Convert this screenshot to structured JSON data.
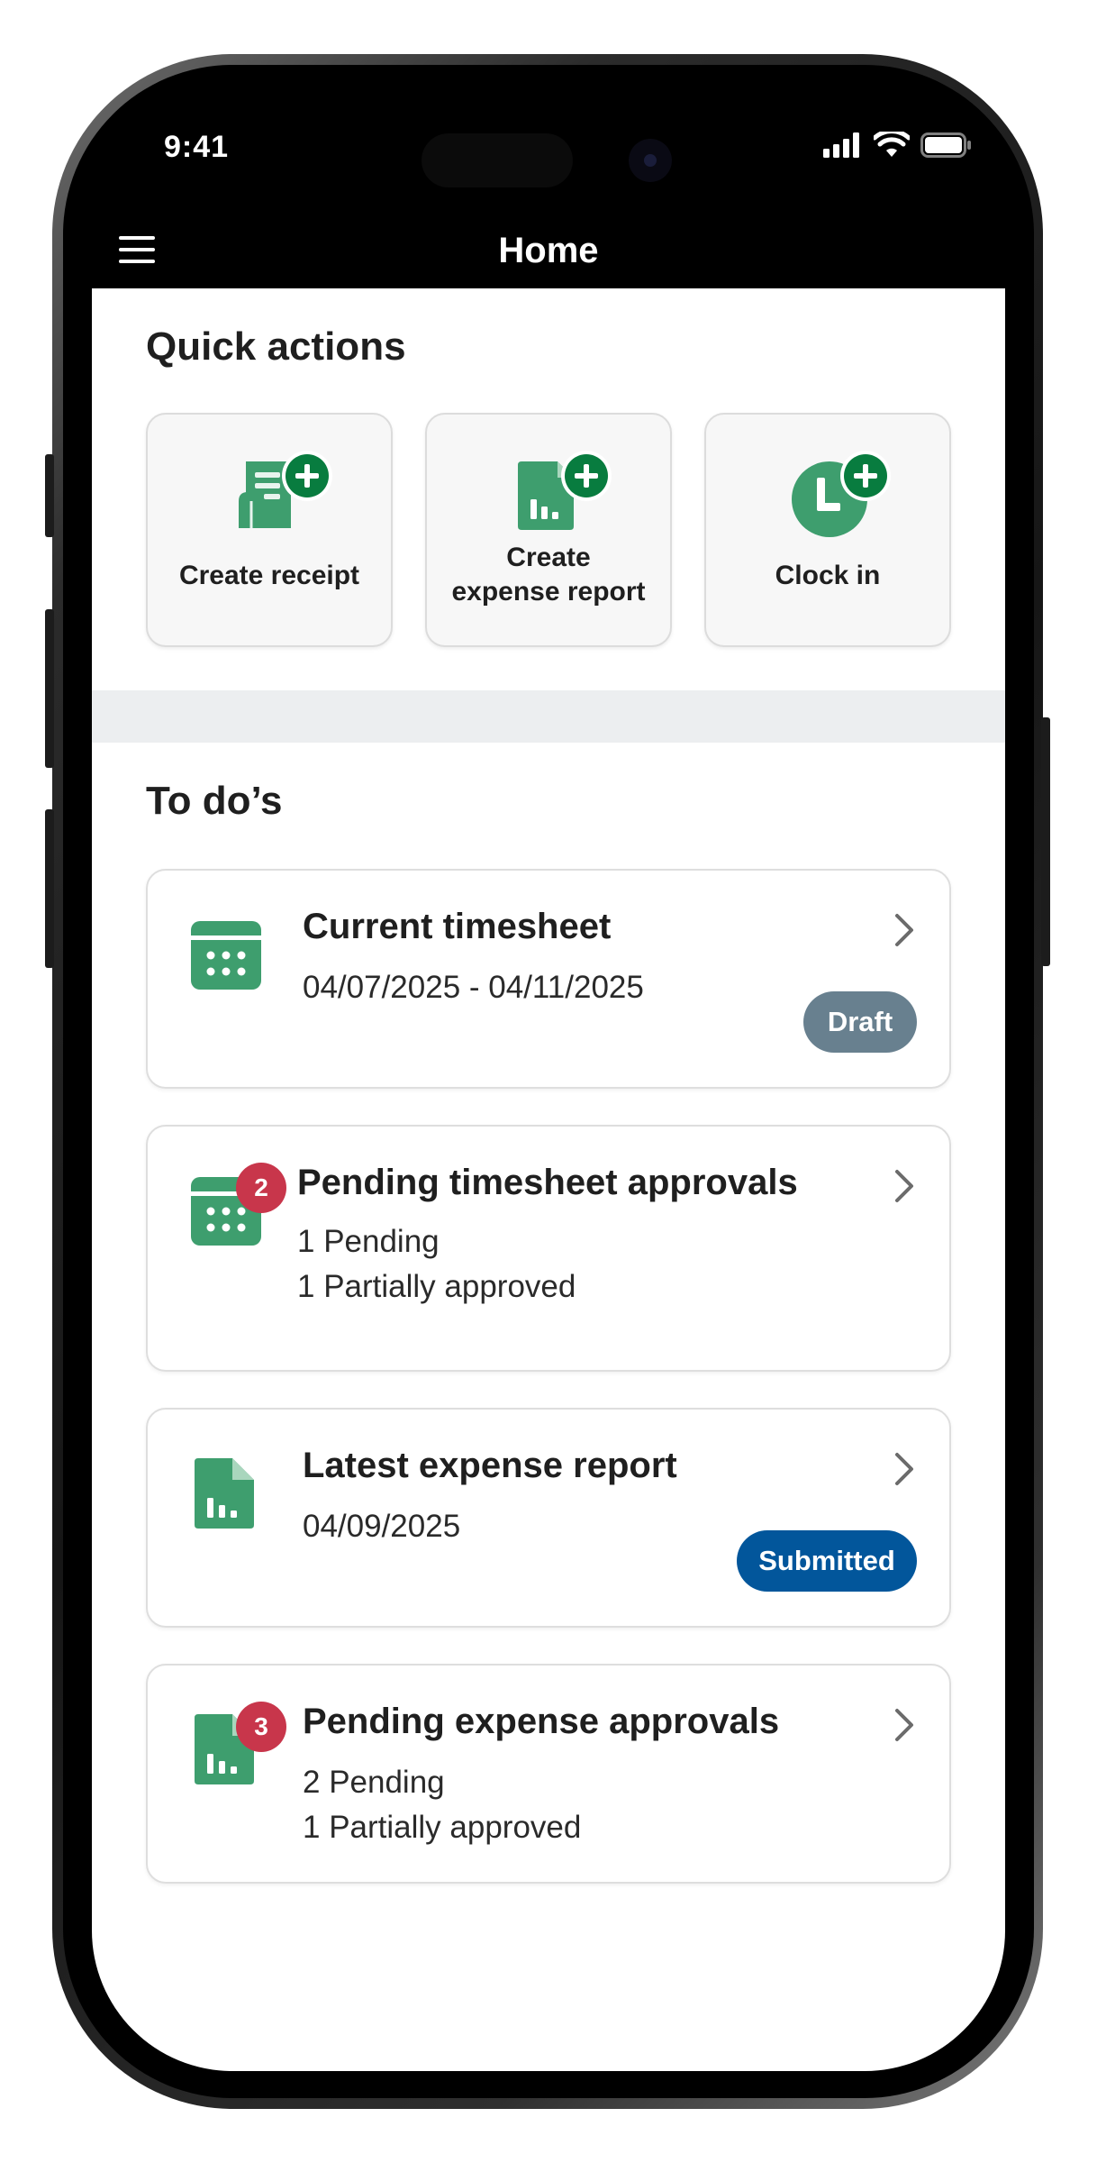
{
  "status_bar": {
    "time": "9:41"
  },
  "nav": {
    "title": "Home"
  },
  "quick_actions": {
    "title": "Quick actions",
    "items": [
      {
        "label": "Create receipt",
        "icon": "receipt-add-icon"
      },
      {
        "label_line1": "Create",
        "label_line2": "expense report",
        "icon": "report-add-icon"
      },
      {
        "label": "Clock in",
        "icon": "clock-add-icon"
      }
    ]
  },
  "todos": {
    "title": "To do’s",
    "cards": [
      {
        "title": "Current timesheet",
        "line1": "04/07/2025 - 04/11/2025",
        "status": "Draft",
        "status_color": "#68808f",
        "icon": "calendar-icon"
      },
      {
        "title": "Pending timesheet approvals",
        "count": "2",
        "line1": "1 Pending",
        "line2": "1 Partially approved",
        "icon": "calendar-icon"
      },
      {
        "title": "Latest expense report",
        "line1": "04/09/2025",
        "status": "Submitted",
        "status_color": "#02569b",
        "icon": "report-icon"
      },
      {
        "title": "Pending expense approvals",
        "count": "3",
        "line1": "2 Pending",
        "line2": "1 Partially approved",
        "icon": "report-icon"
      }
    ]
  },
  "colors": {
    "accent_green": "#3e9e6e",
    "dark_green": "#087c3f",
    "badge_red": "#c8364b"
  }
}
